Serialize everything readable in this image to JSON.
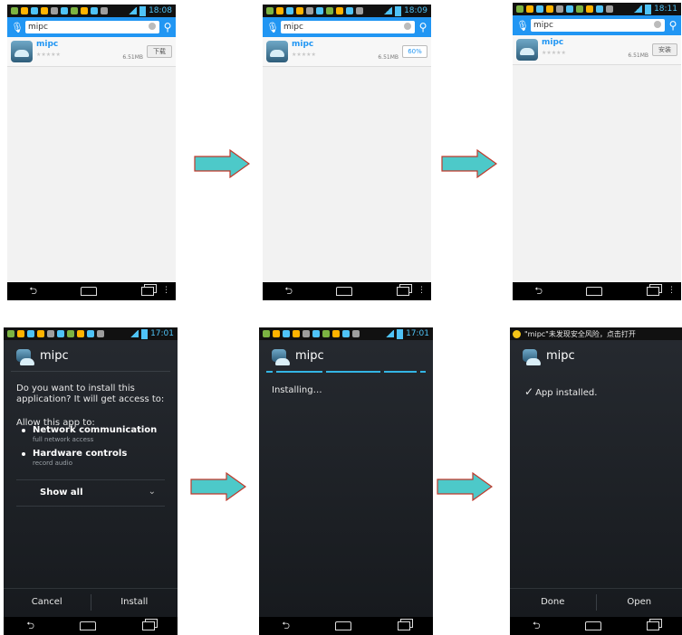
{
  "top": {
    "screen1": {
      "time": "18:08",
      "search_value": "mipc",
      "app_name": "mipc",
      "stars": "★★★★★",
      "size": "6.51MB",
      "action": "下载"
    },
    "screen2": {
      "time": "18:09",
      "search_value": "mipc",
      "app_name": "mipc",
      "stars": "★★★★★",
      "size": "6.51MB",
      "action": "60%"
    },
    "screen3": {
      "time": "18:11",
      "search_value": "mipc",
      "app_name": "mipc",
      "stars": "★★★★★",
      "size": "6.51MB",
      "action": "安装"
    }
  },
  "bottom": {
    "screen4": {
      "time": "17:01",
      "title": "mipc",
      "prompt": "Do you want to install this application? It will get access to:",
      "allow_label": "Allow this app to:",
      "permissions": [
        {
          "name": "Network communication",
          "detail": "full network access"
        },
        {
          "name": "Hardware controls",
          "detail": "record audio"
        }
      ],
      "show_all": "Show all",
      "cancel": "Cancel",
      "install": "Install"
    },
    "screen5": {
      "time": "17:01",
      "title": "mipc",
      "status": "Installing…"
    },
    "screen6": {
      "notification": "\"mipc\"未发现安全风险，点击打开",
      "title": "mipc",
      "status": "App installed.",
      "done": "Done",
      "open": "Open"
    }
  },
  "colors": {
    "arrow_fill": "#4dc9c9",
    "arrow_stroke": "#c0392b",
    "search_bar": "#2196f3",
    "progress": "#33b5e5"
  },
  "icons": {
    "mic": "mic-icon",
    "search": "search-icon",
    "check": "check-icon",
    "chevron": "chevron-down-icon"
  }
}
